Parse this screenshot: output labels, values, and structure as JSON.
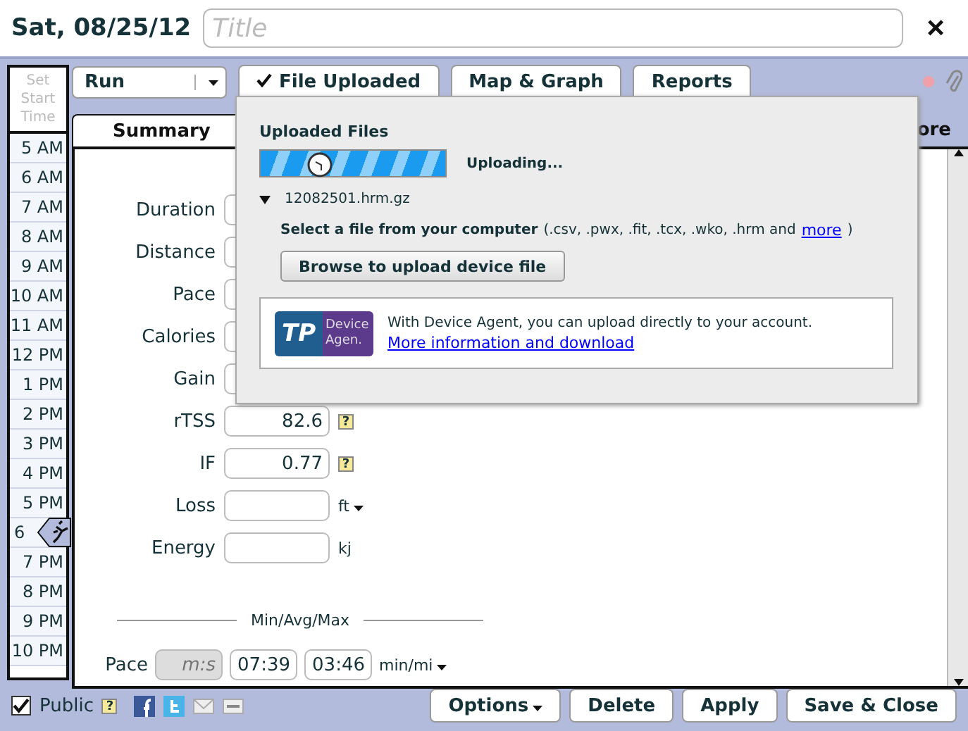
{
  "header": {
    "date": "Sat, 08/25/12",
    "title_placeholder": "Title",
    "close": "×"
  },
  "time_column": {
    "heading": "Set Start Time",
    "slots": [
      {
        "label": "5 AM",
        "marker": false
      },
      {
        "label": "6 AM",
        "marker": false
      },
      {
        "label": "7 AM",
        "marker": false
      },
      {
        "label": "8 AM",
        "marker": false
      },
      {
        "label": "9 AM",
        "marker": false
      },
      {
        "label": "10 AM",
        "marker": false
      },
      {
        "label": "11 AM",
        "marker": false
      },
      {
        "label": "12 PM",
        "marker": false
      },
      {
        "label": "1 PM",
        "marker": false
      },
      {
        "label": "2 PM",
        "marker": false
      },
      {
        "label": "3 PM",
        "marker": false
      },
      {
        "label": "4 PM",
        "marker": false
      },
      {
        "label": "5 PM",
        "marker": false
      },
      {
        "label": "6",
        "marker": true
      },
      {
        "label": "7 PM",
        "marker": false
      },
      {
        "label": "8 PM",
        "marker": false
      },
      {
        "label": "9 PM",
        "marker": false
      },
      {
        "label": "10 PM",
        "marker": false
      }
    ]
  },
  "toolbar": {
    "sport": "Run",
    "buttons": [
      {
        "label": "File Uploaded",
        "checked": true
      },
      {
        "label": "Map & Graph",
        "checked": false
      },
      {
        "label": "Reports",
        "checked": false
      }
    ]
  },
  "tabs": [
    {
      "label": "Summary",
      "selected": true
    },
    {
      "label": "ore",
      "selected": false
    }
  ],
  "summary": {
    "fields": [
      {
        "label": "Duration"
      },
      {
        "label": "Distance"
      },
      {
        "label": "Pace"
      },
      {
        "label": "Calories"
      },
      {
        "label": "Gain"
      },
      {
        "label": "rTSS",
        "value": "82.6",
        "help": "?"
      },
      {
        "label": "IF",
        "value": "0.77",
        "help": "?"
      },
      {
        "label": "Loss",
        "unit": "ft",
        "unit_menu": true
      },
      {
        "label": "Energy",
        "unit": "kj",
        "unit_menu": false
      }
    ]
  },
  "min_avg_max": {
    "title": "Min/Avg/Max",
    "rows": [
      {
        "label": "Pace",
        "min_placeholder": "m:s",
        "avg": "07:39",
        "max": "03:46",
        "unit": "min/mi"
      }
    ]
  },
  "upload_popup": {
    "title": "Uploaded Files",
    "status": "Uploading...",
    "file": "12082501.hrm.gz",
    "prompt": "Select a file from your computer",
    "formats": "(.csv, .pwx, .fit, .tcx, .wko, .hrm and",
    "more_link": "more",
    "close_paren": ")",
    "browse_button": "Browse to upload device file",
    "agent": {
      "logo_mark": "TP",
      "logo_line_1": "Device",
      "logo_line_2": "Agen.",
      "text": "With Device Agent, you can upload directly to your account.",
      "link": "More information and download"
    }
  },
  "footer": {
    "public": {
      "label": "Public",
      "checked": true,
      "help": "?"
    },
    "buttons": [
      {
        "label": "Options",
        "menu": true
      },
      {
        "label": "Delete",
        "menu": false
      },
      {
        "label": "Apply",
        "menu": false
      },
      {
        "label": "Save & Close",
        "menu": false
      }
    ]
  }
}
